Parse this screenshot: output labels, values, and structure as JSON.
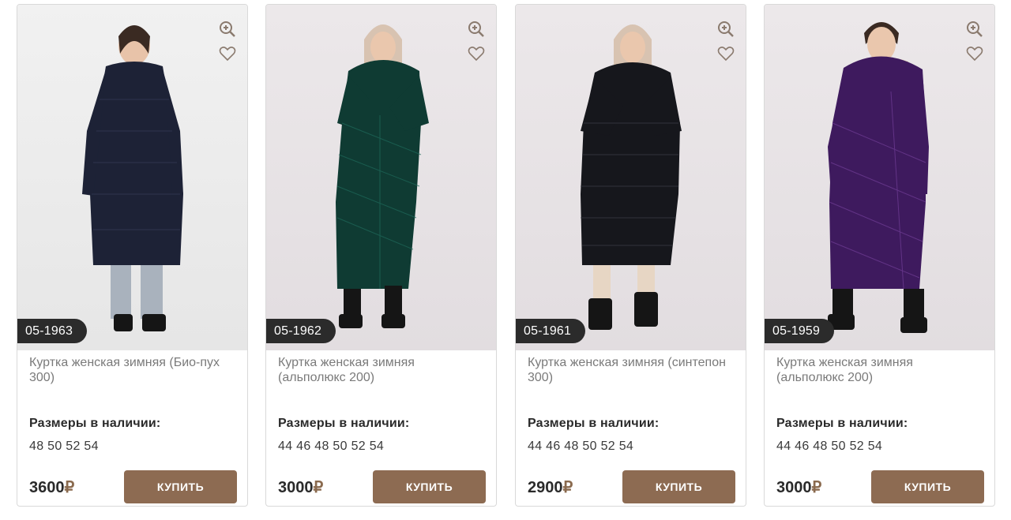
{
  "colors": {
    "accent": "#8d6b52",
    "sku_badge": "#2b2b2b",
    "text_muted": "#7a7a7a"
  },
  "products": [
    {
      "sku": "05-1963",
      "name": "Куртка женская зимняя (Био-пух 300)",
      "sizes_label": "Размеры в наличии:",
      "sizes": "48 50 52 54",
      "price": "3600",
      "currency": "₽",
      "buy_label": "КУПИТЬ",
      "coat_color": "#1d2236",
      "icons": [
        "zoom-in-icon",
        "heart-icon"
      ]
    },
    {
      "sku": "05-1962",
      "name": "Куртка женская зимняя (альполюкс 200)",
      "sizes_label": "Размеры в наличии:",
      "sizes": "44 46 48 50 52 54",
      "price": "3000",
      "currency": "₽",
      "buy_label": "КУПИТЬ",
      "coat_color": "#0f3b33",
      "icons": [
        "zoom-in-icon",
        "heart-icon"
      ]
    },
    {
      "sku": "05-1961",
      "name": "Куртка женская зимняя (синтепон 300)",
      "sizes_label": "Размеры в наличии:",
      "sizes": "44 46 48 50 52 54",
      "price": "2900",
      "currency": "₽",
      "buy_label": "КУПИТЬ",
      "coat_color": "#16171c",
      "icons": [
        "zoom-in-icon",
        "heart-icon"
      ]
    },
    {
      "sku": "05-1959",
      "name": "Куртка женская зимняя (альполюкс 200)",
      "sizes_label": "Размеры в наличии:",
      "sizes": "44 46 48 50 52 54",
      "price": "3000",
      "currency": "₽",
      "buy_label": "КУПИТЬ",
      "coat_color": "#3e1a5e",
      "icons": [
        "zoom-in-icon",
        "heart-icon"
      ]
    }
  ]
}
